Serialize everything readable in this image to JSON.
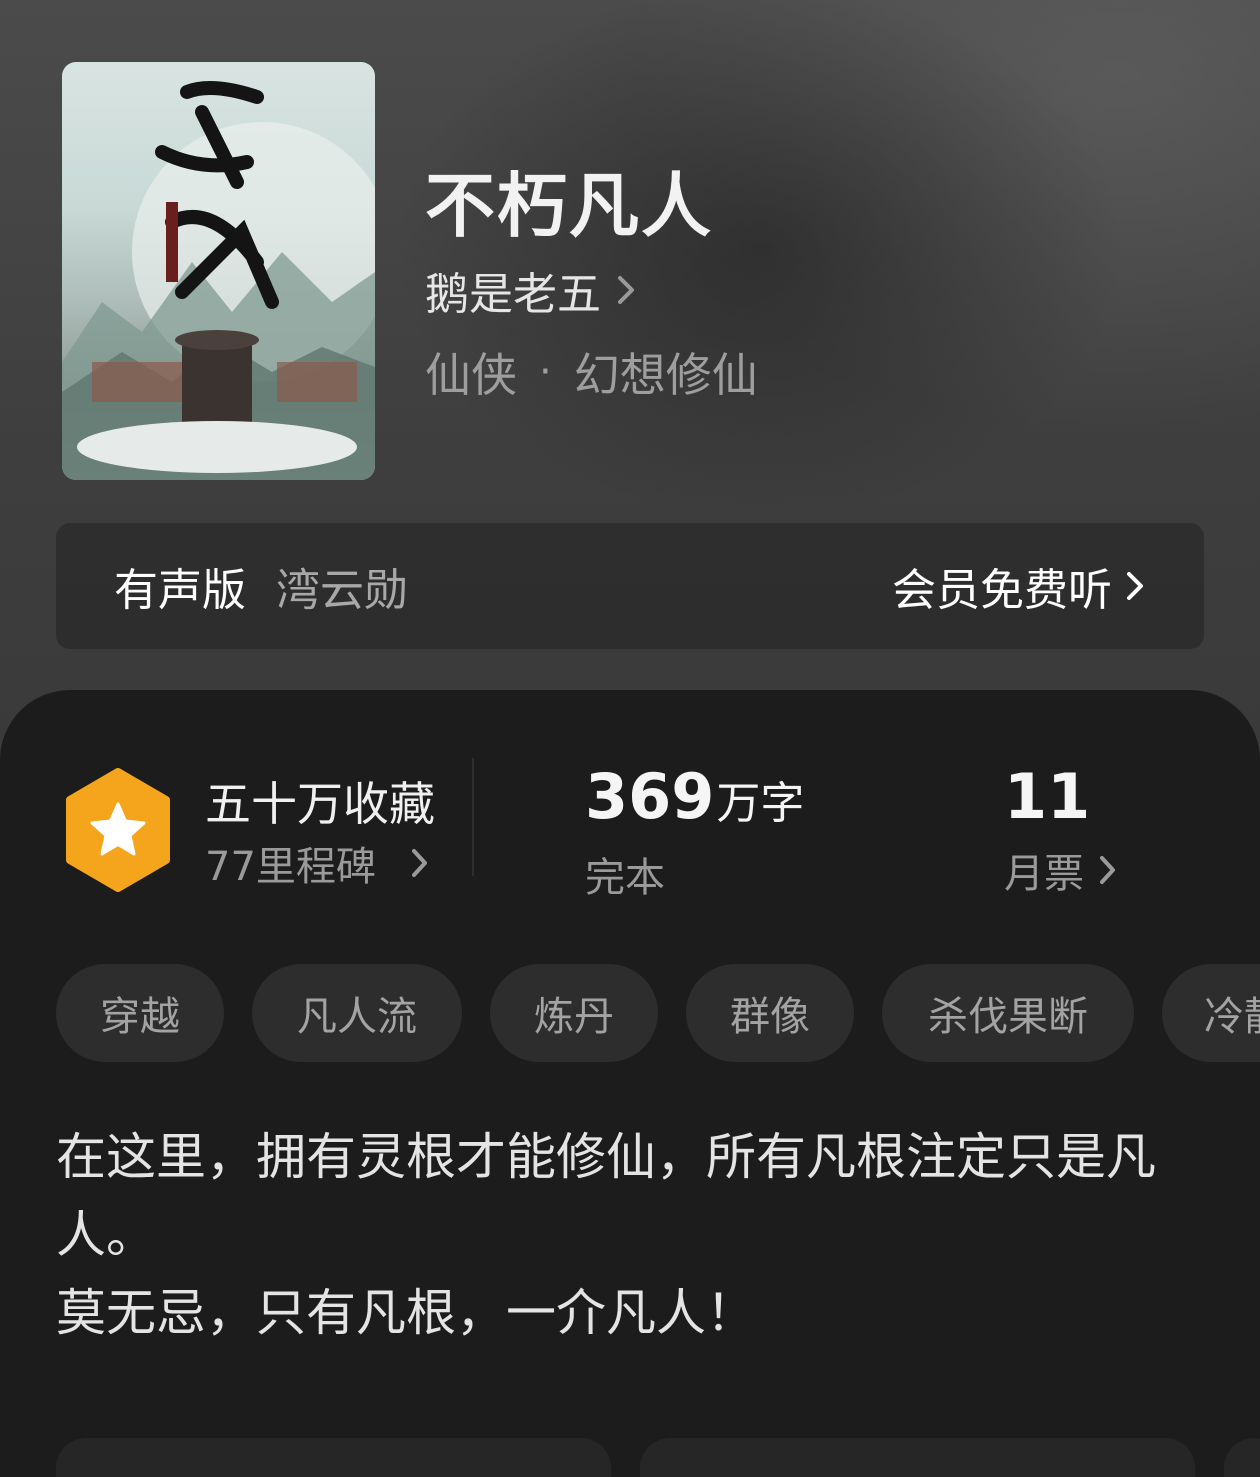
{
  "book": {
    "title": "不朽凡人",
    "author": "鹅是老五",
    "genre": "仙侠",
    "subgenre": "幻想修仙",
    "genre_separator": "·"
  },
  "audio": {
    "label": "有声版",
    "narrator": "湾云勋",
    "action": "会员免费听"
  },
  "stats": {
    "collections": "五十万收藏",
    "milestones": "77里程碑",
    "word_count": "369",
    "word_unit": "万字",
    "status": "完本",
    "monthly_votes": "11",
    "monthly_votes_label": "月票"
  },
  "tags": [
    "穿越",
    "凡人流",
    "炼丹",
    "群像",
    "杀伐果断",
    "冷静"
  ],
  "synopsis": {
    "line1": "在这里，拥有灵根才能修仙，所有凡根注定只是凡人。",
    "line2": "莫无忌，只有凡根，一介凡人！"
  },
  "colors": {
    "panel_bg": "#1c1c1c",
    "tag_bg": "#2d2d2d",
    "badge": "#f5a51c"
  },
  "icons": {
    "badge": "star-hexagon-icon",
    "chevron": "chevron-right-icon"
  }
}
